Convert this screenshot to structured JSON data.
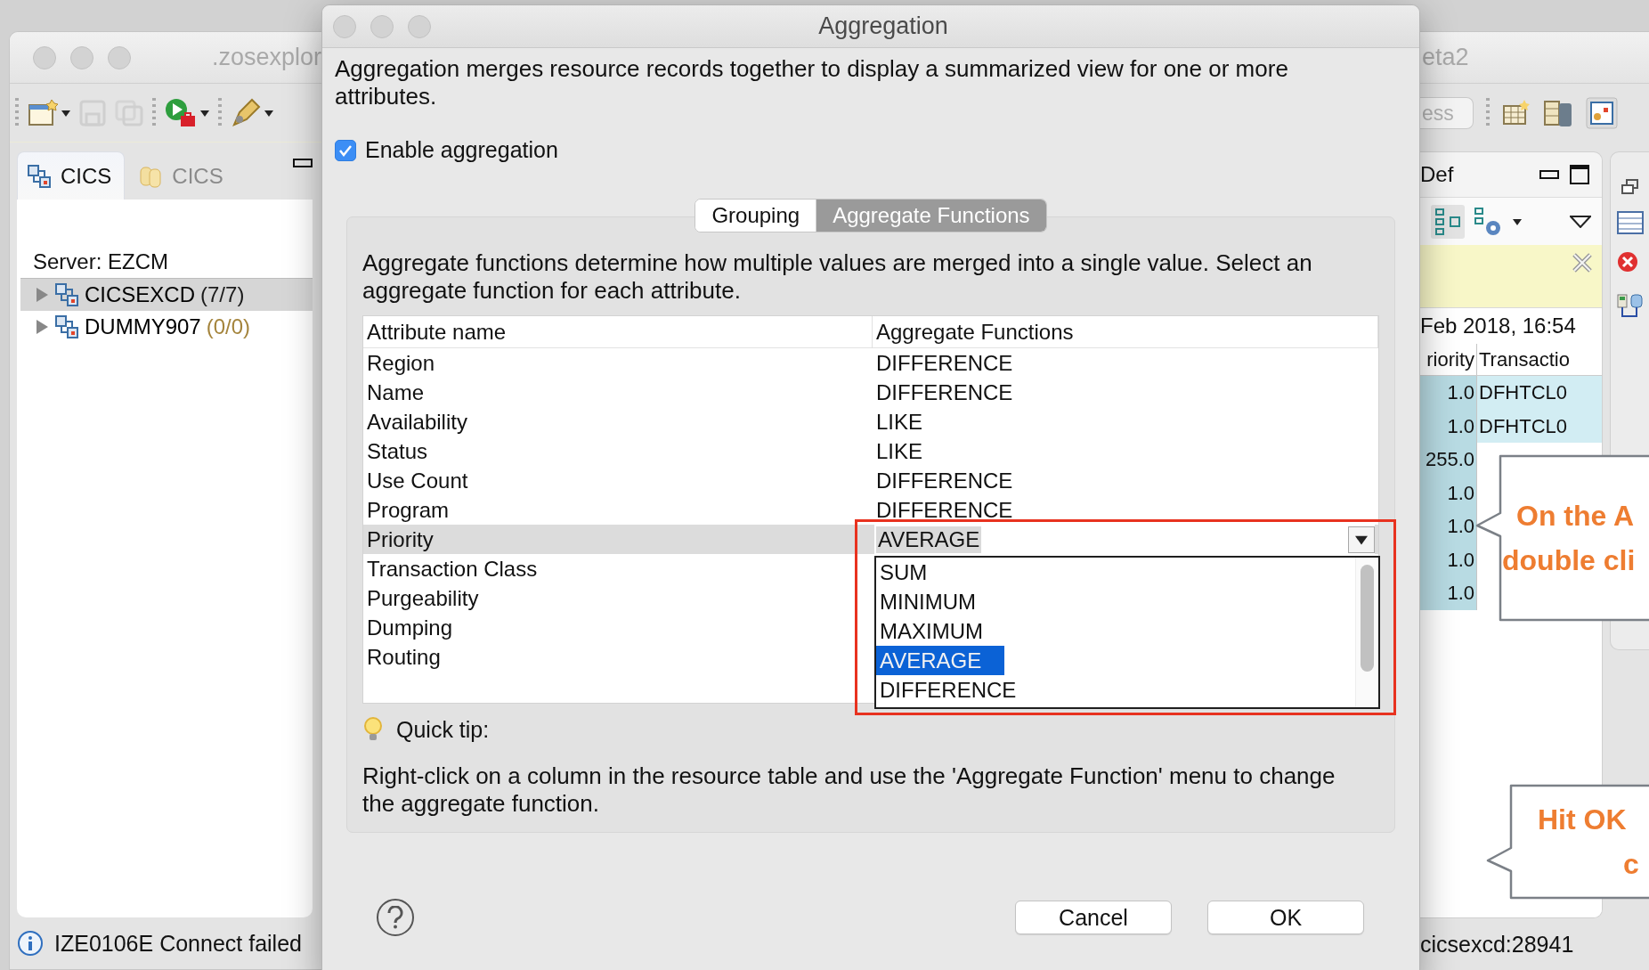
{
  "left_window": {
    "title": ".zosexplor",
    "tabs": [
      {
        "label": "CICS",
        "kind": "systems",
        "selected": true
      },
      {
        "label": "CICS",
        "kind": "repository",
        "selected": false
      }
    ],
    "server_label": "Server: EZCM",
    "tree": [
      {
        "name": "CICSEXCD",
        "count": "(7/7)",
        "color": "#1a1a1a",
        "selected": true,
        "expanded": false
      },
      {
        "name": "DUMMY907",
        "count": "(0/0)",
        "color": "#a4843c",
        "selected": false,
        "expanded": false
      }
    ],
    "status": "IZE0106E Connect failed"
  },
  "dialog": {
    "title": "Aggregation",
    "description": "Aggregation merges resource records together to display a summarized view for one or more attributes.",
    "enable_aggregation": {
      "label": "Enable aggregation",
      "checked": true
    },
    "tabs": [
      {
        "label": "Grouping",
        "selected": false
      },
      {
        "label": "Aggregate Functions",
        "selected": true
      }
    ],
    "functions_description": "Aggregate functions determine how multiple values are merged into a single value. Select an aggregate function for each attribute.",
    "table": {
      "columns": [
        "Attribute name",
        "Aggregate Functions"
      ],
      "rows": [
        {
          "attribute": "Region",
          "function": "DIFFERENCE",
          "selected": false
        },
        {
          "attribute": "Name",
          "function": "DIFFERENCE",
          "selected": false
        },
        {
          "attribute": "Availability",
          "function": "LIKE",
          "selected": false
        },
        {
          "attribute": "Status",
          "function": "LIKE",
          "selected": false
        },
        {
          "attribute": "Use Count",
          "function": "DIFFERENCE",
          "selected": false
        },
        {
          "attribute": "Program",
          "function": "DIFFERENCE",
          "selected": false
        },
        {
          "attribute": "Priority",
          "function": "AVERAGE",
          "selected": true
        },
        {
          "attribute": "Transaction Class",
          "selected": false
        },
        {
          "attribute": "Purgeability",
          "selected": false
        },
        {
          "attribute": "Dumping",
          "selected": false
        },
        {
          "attribute": "Routing",
          "selected": false
        }
      ]
    },
    "dropdown_options": [
      {
        "label": "SUM",
        "selected": false
      },
      {
        "label": "MINIMUM",
        "selected": false
      },
      {
        "label": "MAXIMUM",
        "selected": false
      },
      {
        "label": "AVERAGE",
        "selected": true
      },
      {
        "label": "DIFFERENCE",
        "selected": false
      }
    ],
    "quick_tip": {
      "title": "Quick tip:",
      "text": "Right-click on a column in the resource table and use the 'Aggregate Function' menu to change the aggregate function."
    },
    "buttons": [
      "Cancel",
      "OK"
    ]
  },
  "right_window": {
    "title": "eta2",
    "search": {
      "value": "ess"
    },
    "tab": "Def",
    "timestamp": "Feb 2018, 16:54",
    "columns": [
      "riority",
      "Transactio"
    ],
    "rows": [
      {
        "priority": "1.0",
        "transaction": "DFHTCL0"
      },
      {
        "priority": "1.0",
        "transaction": "DFHTCL0"
      },
      {
        "priority": "255.0"
      },
      {
        "priority": "1.0"
      },
      {
        "priority": "1.0"
      },
      {
        "priority": "1.0"
      },
      {
        "priority": "1.0"
      }
    ],
    "status": "cicsexcd:28941"
  },
  "callouts": [
    {
      "lines": [
        "On the A",
        "double cli"
      ]
    },
    {
      "lines": [
        "Hit OK",
        "c"
      ]
    }
  ]
}
